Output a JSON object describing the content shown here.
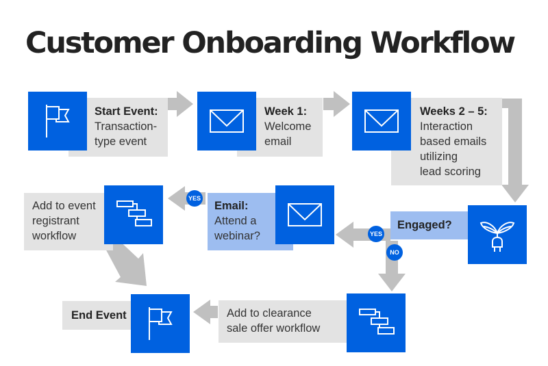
{
  "title": "Customer Onboarding Workflow",
  "colors": {
    "accent": "#0061e0",
    "label_gray": "#e3e3e3",
    "label_blue": "#9dbdf0",
    "arrow": "#c0c0c0",
    "title": "#222222"
  },
  "nodes": {
    "start": {
      "icon": "flag-icon",
      "heading": "Start Event:",
      "text": "Transaction-\ntype event"
    },
    "week1": {
      "icon": "envelope-icon",
      "heading": "Week 1:",
      "text": "Welcome\nemail"
    },
    "weeks2_5": {
      "icon": "envelope-icon",
      "heading": "Weeks 2 – 5:",
      "text": "Interaction\nbased emails\nutilizing\nlead scoring"
    },
    "engaged": {
      "icon": "plant-plug-icon",
      "heading": "Engaged?"
    },
    "webinar": {
      "icon": "envelope-icon",
      "heading": "Email:",
      "text": "Attend a\nwebinar?"
    },
    "registrant": {
      "icon": "workflow-icon",
      "text": "Add to event\nregistrant\nworkflow"
    },
    "clearance": {
      "icon": "workflow-icon",
      "text": "Add to clearance\nsale offer workflow"
    },
    "end": {
      "icon": "flag-icon",
      "heading": "End Event"
    }
  },
  "badges": {
    "engaged_yes": "YES",
    "engaged_no": "NO",
    "webinar_yes": "YES"
  }
}
